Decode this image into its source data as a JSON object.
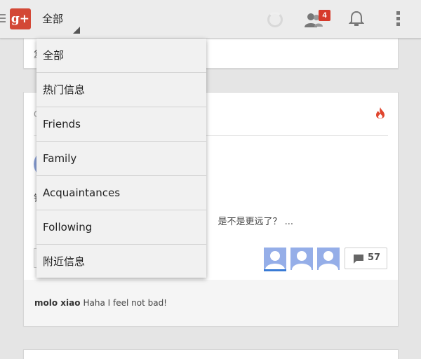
{
  "topbar": {
    "app_logo_text": "g+",
    "stream_selector_label": "全部",
    "notifications_badge": "4"
  },
  "dropdown": {
    "items": [
      {
        "label": "全部"
      },
      {
        "label": "热门信息"
      },
      {
        "label": "Friends"
      },
      {
        "label": "Family"
      },
      {
        "label": "Acquaintances"
      },
      {
        "label": "Following"
      },
      {
        "label": "附近信息"
      }
    ]
  },
  "post": {
    "truncated_text": "是不是更远了？ ...",
    "comment_count": "57",
    "latest_comment": {
      "author": "molo xiao",
      "text": "Haha I feel not bad!"
    }
  },
  "colors": {
    "brand": "#d34836",
    "badge": "#d63a2a",
    "hot": "#e0452e"
  },
  "icons": [
    "menu-drawer-icon",
    "google-plus-logo",
    "spinner-icon",
    "people-icon",
    "bell-icon",
    "overflow-menu-icon",
    "hot-flame-icon",
    "comment-icon"
  ]
}
